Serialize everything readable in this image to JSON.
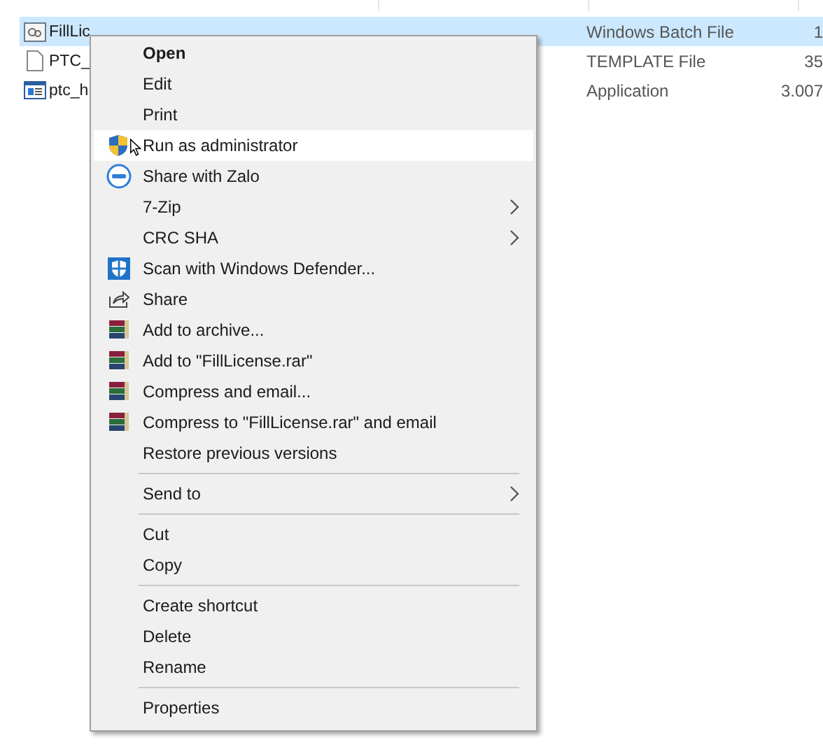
{
  "files": [
    {
      "name": "FillLic",
      "type": "Windows Batch File",
      "size": "1",
      "kind": "batch",
      "selected": true
    },
    {
      "name": "PTC_",
      "type": "TEMPLATE File",
      "size": "35",
      "kind": "template",
      "selected": false
    },
    {
      "name": "ptc_h",
      "type": "Application",
      "size": "3.007",
      "kind": "application",
      "selected": false
    }
  ],
  "context_menu": {
    "items": [
      {
        "kind": "plain",
        "label": "Open",
        "default": true,
        "highlighted": false,
        "submenu": false
      },
      {
        "kind": "plain",
        "label": "Edit",
        "default": false,
        "highlighted": false,
        "submenu": false
      },
      {
        "kind": "plain",
        "label": "Print",
        "default": false,
        "highlighted": false,
        "submenu": false
      },
      {
        "kind": "admin",
        "label": "Run as administrator",
        "default": false,
        "highlighted": true,
        "submenu": false
      },
      {
        "kind": "zalo",
        "label": "Share with Zalo",
        "default": false,
        "highlighted": false,
        "submenu": false
      },
      {
        "kind": "plain",
        "label": "7-Zip",
        "default": false,
        "highlighted": false,
        "submenu": true
      },
      {
        "kind": "plain",
        "label": "CRC SHA",
        "default": false,
        "highlighted": false,
        "submenu": true
      },
      {
        "kind": "defender",
        "label": "Scan with Windows Defender...",
        "default": false,
        "highlighted": false,
        "submenu": false
      },
      {
        "kind": "share",
        "label": "Share",
        "default": false,
        "highlighted": false,
        "submenu": false
      },
      {
        "kind": "archive",
        "label": "Add to archive...",
        "default": false,
        "highlighted": false,
        "submenu": false
      },
      {
        "kind": "archive",
        "label": "Add to \"FillLicense.rar\"",
        "default": false,
        "highlighted": false,
        "submenu": false
      },
      {
        "kind": "archive",
        "label": "Compress and email...",
        "default": false,
        "highlighted": false,
        "submenu": false
      },
      {
        "kind": "archive",
        "label": "Compress to \"FillLicense.rar\" and email",
        "default": false,
        "highlighted": false,
        "submenu": false
      },
      {
        "kind": "plain",
        "label": "Restore previous versions",
        "default": false,
        "highlighted": false,
        "submenu": false
      },
      {
        "kind": "separator"
      },
      {
        "kind": "plain",
        "label": "Send to",
        "default": false,
        "highlighted": false,
        "submenu": true
      },
      {
        "kind": "separator"
      },
      {
        "kind": "plain",
        "label": "Cut",
        "default": false,
        "highlighted": false,
        "submenu": false
      },
      {
        "kind": "plain",
        "label": "Copy",
        "default": false,
        "highlighted": false,
        "submenu": false
      },
      {
        "kind": "separator"
      },
      {
        "kind": "plain",
        "label": "Create shortcut",
        "default": false,
        "highlighted": false,
        "submenu": false
      },
      {
        "kind": "plain",
        "label": "Delete",
        "default": false,
        "highlighted": false,
        "submenu": false
      },
      {
        "kind": "plain",
        "label": "Rename",
        "default": false,
        "highlighted": false,
        "submenu": false
      },
      {
        "kind": "separator"
      },
      {
        "kind": "plain",
        "label": "Properties",
        "default": false,
        "highlighted": false,
        "submenu": false
      }
    ]
  }
}
